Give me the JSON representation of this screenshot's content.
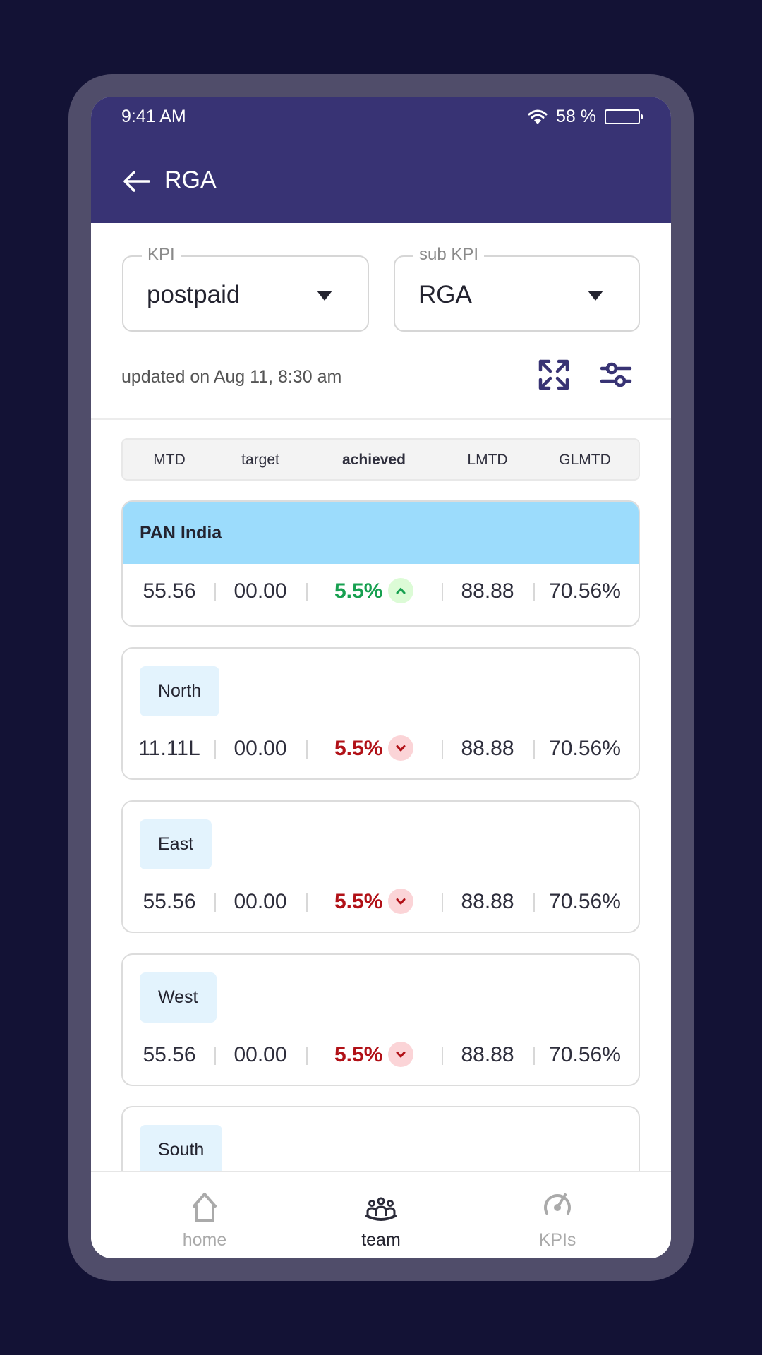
{
  "status_bar": {
    "time": "9:41 AM",
    "battery": "58 %"
  },
  "app_bar": {
    "title": "RGA"
  },
  "filters": {
    "kpi": {
      "label": "KPI",
      "value": "postpaid"
    },
    "sub_kpi": {
      "label": "sub KPI",
      "value": "RGA"
    }
  },
  "updated_text": "updated on Aug 11, 8:30 am",
  "columns": [
    "MTD",
    "target",
    "achieved",
    "LMTD",
    "GLMTD"
  ],
  "regions": [
    {
      "name": "PAN India",
      "mtd": "55.56",
      "target": "00.00",
      "achieved": "5.5%",
      "trend": "up",
      "lmtd": "88.88",
      "glmtd": "70.56%"
    },
    {
      "name": "North",
      "mtd": "11.11L",
      "target": "00.00",
      "achieved": "5.5%",
      "trend": "down",
      "lmtd": "88.88",
      "glmtd": "70.56%"
    },
    {
      "name": "East",
      "mtd": "55.56",
      "target": "00.00",
      "achieved": "5.5%",
      "trend": "down",
      "lmtd": "88.88",
      "glmtd": "70.56%"
    },
    {
      "name": "West",
      "mtd": "55.56",
      "target": "00.00",
      "achieved": "5.5%",
      "trend": "down",
      "lmtd": "88.88",
      "glmtd": "70.56%"
    },
    {
      "name": "South"
    }
  ],
  "nav": [
    {
      "label": "home",
      "icon": "home-icon",
      "active": false
    },
    {
      "label": "team",
      "icon": "team-icon",
      "active": true
    },
    {
      "label": "KPIs",
      "icon": "speedometer-icon",
      "active": false
    }
  ],
  "colors": {
    "primary": "#383374",
    "up": "#17a050",
    "down": "#b11117",
    "highlight": "#9cdcfc"
  }
}
